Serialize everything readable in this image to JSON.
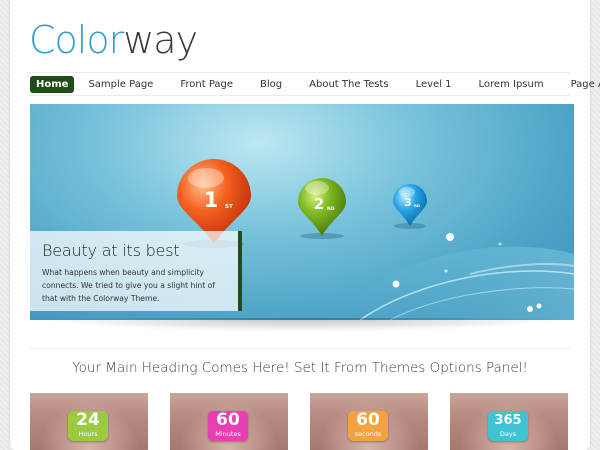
{
  "logo": {
    "part1": "Color",
    "part2": "way"
  },
  "nav": {
    "items": [
      {
        "label": "Home",
        "active": true
      },
      {
        "label": "Sample Page"
      },
      {
        "label": "Front Page"
      },
      {
        "label": "Blog"
      },
      {
        "label": "About The Tests"
      },
      {
        "label": "Level 1"
      },
      {
        "label": "Lorem Ipsum"
      },
      {
        "label": "Page A"
      }
    ]
  },
  "slider": {
    "pins": [
      {
        "num": "1",
        "sup": "ST",
        "color": "#f0541e"
      },
      {
        "num": "2",
        "sup": "ND",
        "color": "#7bb51f"
      },
      {
        "num": "3",
        "sup": "RD",
        "color": "#24a3e3"
      }
    ],
    "caption": {
      "title": "Beauty at its best",
      "text": "What happens when beauty and simplicity connects. We tried to give you a slight hint of that with the Colorway Theme."
    }
  },
  "main_heading": "Your Main Heading Comes Here! Set It From Themes Options Panel!",
  "thumbs": [
    {
      "num": "24",
      "unit": "Hours",
      "color": "#9acb3e"
    },
    {
      "num": "60",
      "unit": "Minutes",
      "color": "#e63fb2"
    },
    {
      "num": "60",
      "unit": "seconds",
      "color": "#f4a23f"
    },
    {
      "num": "365",
      "unit": "Days",
      "color": "#3fc3d3"
    }
  ]
}
